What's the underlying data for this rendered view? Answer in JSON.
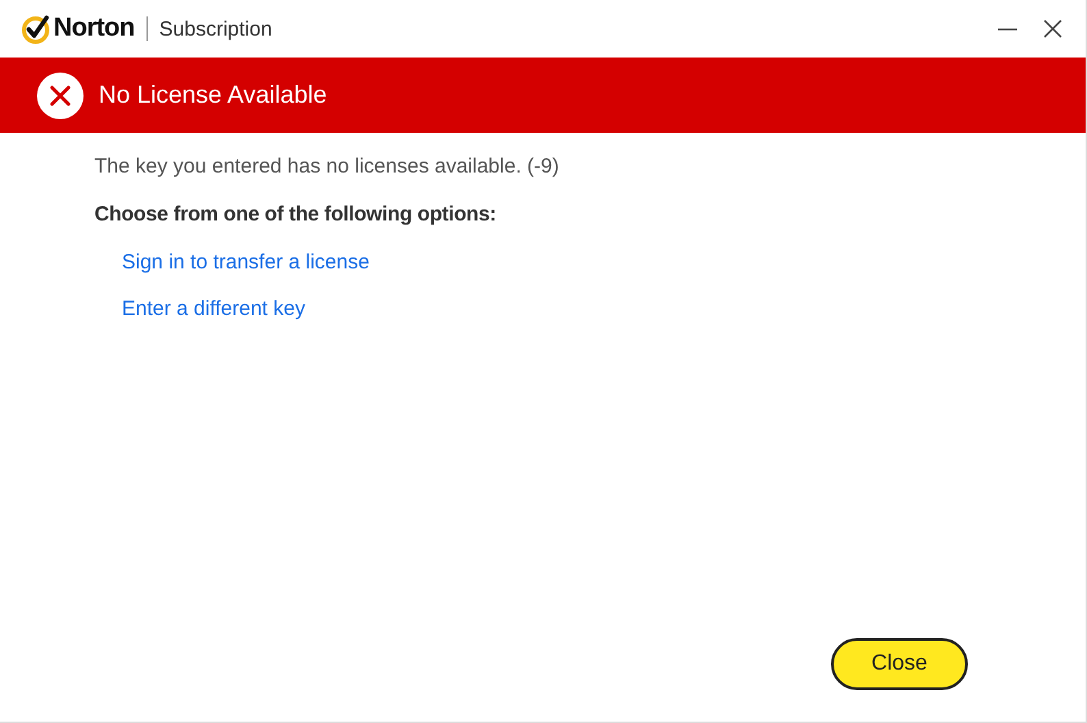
{
  "window": {
    "brand": "Norton",
    "title": "Subscription"
  },
  "banner": {
    "title": "No License Available"
  },
  "message": "The key you entered has no licenses available. (-9)",
  "prompt": "Choose from one of the following options:",
  "options": [
    "Sign in to transfer a license",
    "Enter a different key"
  ],
  "buttons": [
    "Close"
  ]
}
